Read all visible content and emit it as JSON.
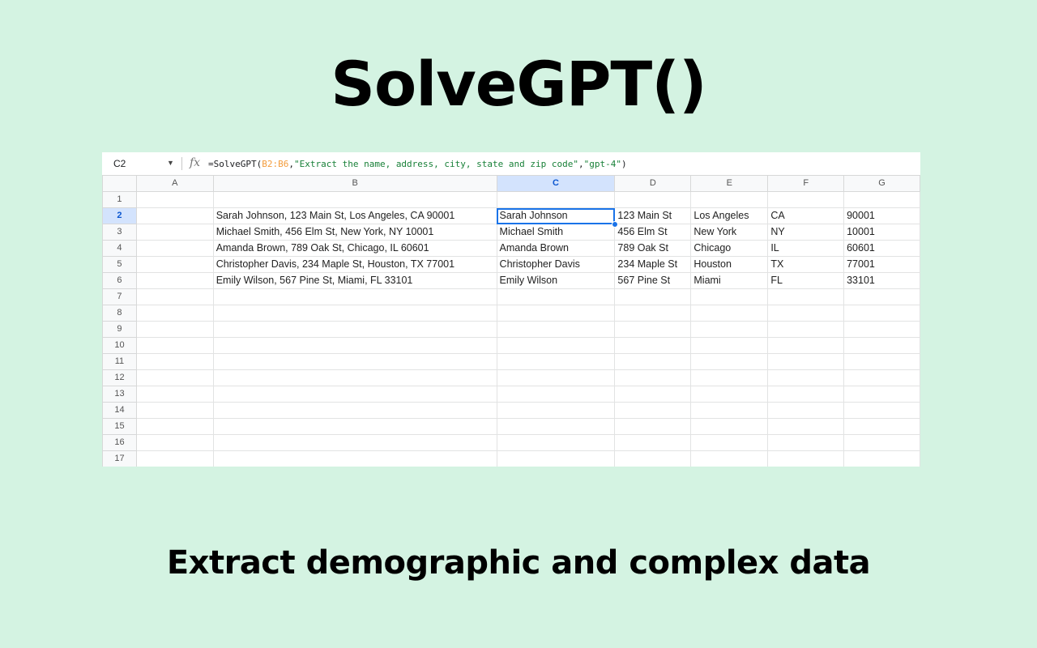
{
  "hero": {
    "title": "SolveGPT()",
    "tagline": "Extract demographic and complex data"
  },
  "formula_bar": {
    "name_box": "C2",
    "fx_label": "fx",
    "formula_prefix": "=SolveGPT(",
    "formula_ref": "B2:B6",
    "formula_sep1": ",",
    "formula_str1": "\"Extract the name, address, city, state and zip code\"",
    "formula_sep2": ",",
    "formula_str2": "\"gpt-4\"",
    "formula_suffix": ")"
  },
  "sheet": {
    "columns": [
      "A",
      "B",
      "C",
      "D",
      "E",
      "F",
      "G"
    ],
    "active_cell": "C2",
    "rows": [
      {
        "num": "1",
        "cells": [
          "",
          "",
          "",
          "",
          "",
          "",
          ""
        ]
      },
      {
        "num": "2",
        "cells": [
          "",
          "Sarah Johnson, 123 Main St, Los Angeles,  CA 90001",
          "Sarah Johnson",
          "123 Main St",
          "Los Angeles",
          "CA",
          "90001"
        ]
      },
      {
        "num": "3",
        "cells": [
          "",
          "Michael Smith, 456 Elm St, New York, NY 10001",
          "Michael Smith",
          "456 Elm St",
          "New York",
          "NY",
          "10001"
        ]
      },
      {
        "num": "4",
        "cells": [
          "",
          "Amanda Brown, 789 Oak St, Chicago, IL 60601",
          "Amanda Brown",
          "789 Oak St",
          "Chicago",
          "IL",
          "60601"
        ]
      },
      {
        "num": "5",
        "cells": [
          "",
          "Christopher Davis, 234 Maple St, Houston, TX 77001",
          "Christopher Davis",
          "234 Maple St",
          "Houston",
          "TX",
          "77001"
        ]
      },
      {
        "num": "6",
        "cells": [
          "",
          "Emily Wilson, 567 Pine St, Miami, FL 33101",
          "Emily Wilson",
          "567 Pine St",
          "Miami",
          "FL",
          "33101"
        ]
      },
      {
        "num": "7",
        "cells": [
          "",
          "",
          "",
          "",
          "",
          "",
          ""
        ]
      },
      {
        "num": "8",
        "cells": [
          "",
          "",
          "",
          "",
          "",
          "",
          ""
        ]
      },
      {
        "num": "9",
        "cells": [
          "",
          "",
          "",
          "",
          "",
          "",
          ""
        ]
      },
      {
        "num": "10",
        "cells": [
          "",
          "",
          "",
          "",
          "",
          "",
          ""
        ]
      },
      {
        "num": "11",
        "cells": [
          "",
          "",
          "",
          "",
          "",
          "",
          ""
        ]
      },
      {
        "num": "12",
        "cells": [
          "",
          "",
          "",
          "",
          "",
          "",
          ""
        ]
      },
      {
        "num": "13",
        "cells": [
          "",
          "",
          "",
          "",
          "",
          "",
          ""
        ]
      },
      {
        "num": "14",
        "cells": [
          "",
          "",
          "",
          "",
          "",
          "",
          ""
        ]
      },
      {
        "num": "15",
        "cells": [
          "",
          "",
          "",
          "",
          "",
          "",
          ""
        ]
      },
      {
        "num": "16",
        "cells": [
          "",
          "",
          "",
          "",
          "",
          "",
          ""
        ]
      },
      {
        "num": "17",
        "cells": [
          "",
          "",
          "",
          "",
          "",
          "",
          ""
        ]
      }
    ]
  },
  "colors": {
    "background": "#d4f3e2",
    "selection": "#1a73e8",
    "formula_ref": "#f39c3c",
    "formula_string": "#188038"
  }
}
